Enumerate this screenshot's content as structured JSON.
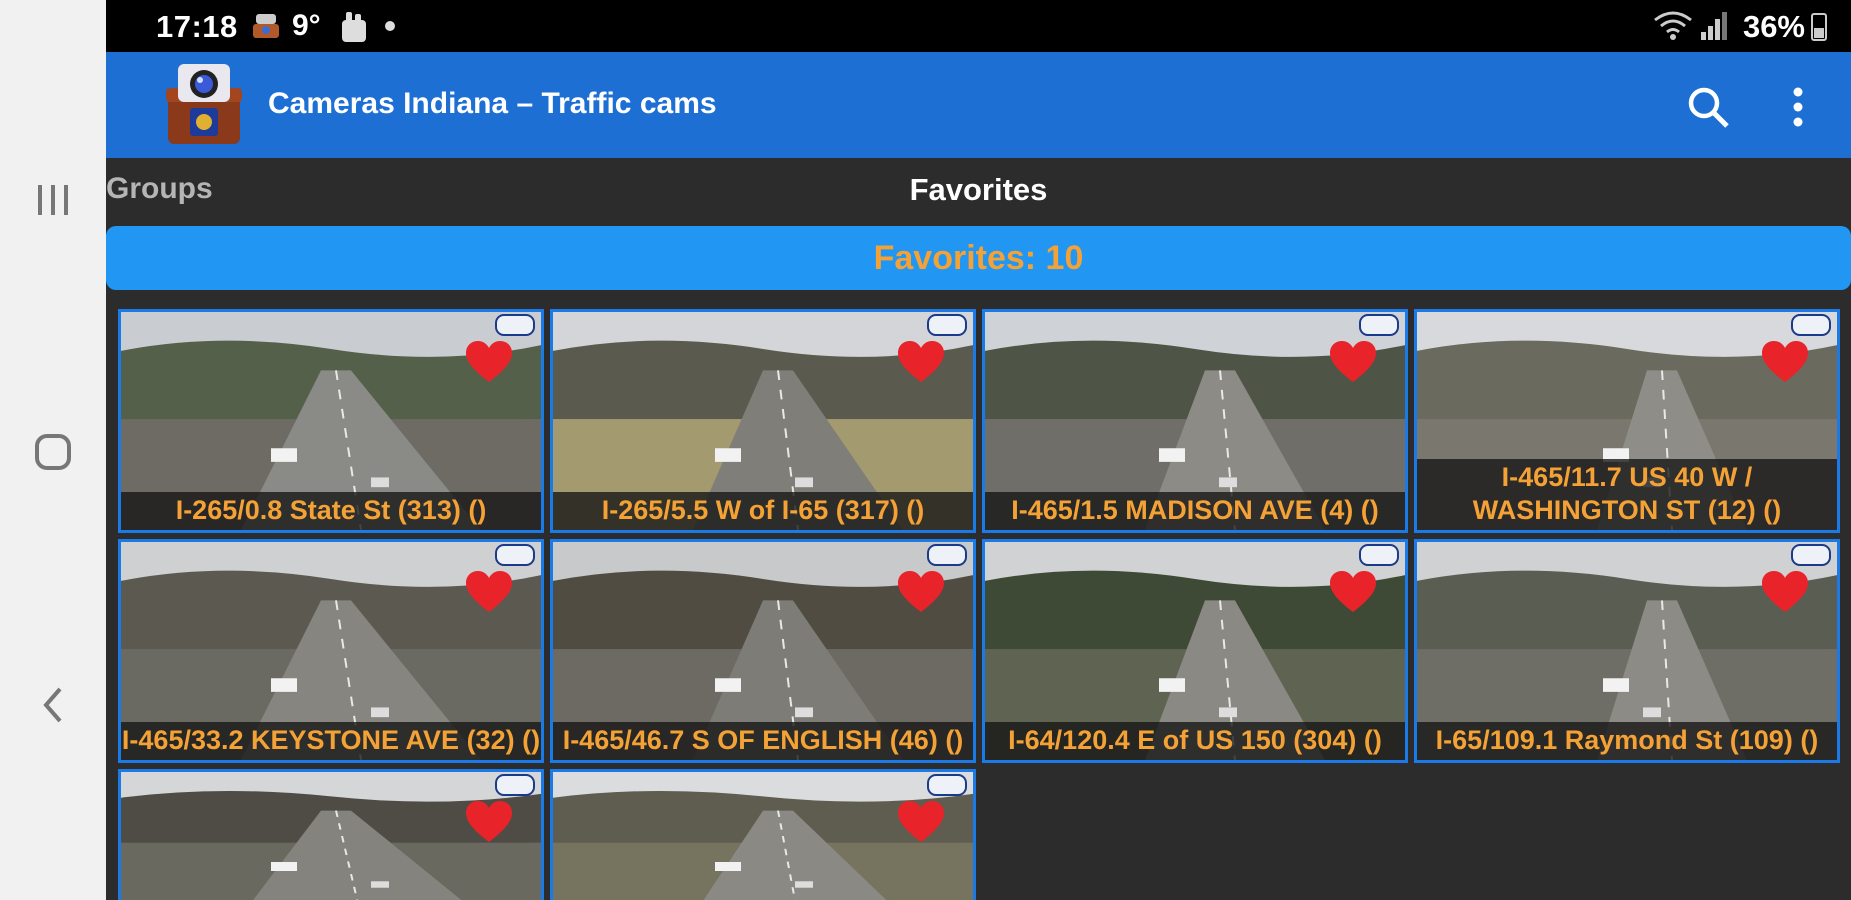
{
  "status_bar": {
    "time": "17:18",
    "temperature": "9°",
    "battery": "36%"
  },
  "app_bar": {
    "title": "Cameras Indiana – Traffic cams"
  },
  "tabs": {
    "groups": "Groups",
    "favorites": "Favorites"
  },
  "favorites_banner": "Favorites: 10",
  "colors": {
    "app_bar": "#1e6fd4",
    "banner": "#2196f3",
    "label_text": "#f4a235",
    "heart": "#e8232a",
    "background": "#2c2c2c"
  },
  "cameras": [
    {
      "label": "I-265/0.8 State St (313) ()",
      "favorite": true
    },
    {
      "label": "I-265/5.5 W of I-65  (317) ()",
      "favorite": true
    },
    {
      "label": "I-465/1.5 MADISON AVE (4) ()",
      "favorite": true
    },
    {
      "label": "I-465/11.7  US 40 W / WASHINGTON ST  (12) ()",
      "favorite": true
    },
    {
      "label": "I-465/33.2 KEYSTONE AVE  (32) ()",
      "favorite": true
    },
    {
      "label": "I-465/46.7  S OF ENGLISH (46) ()",
      "favorite": true
    },
    {
      "label": "I-64/120.4  E of US 150 (304) ()",
      "favorite": true
    },
    {
      "label": "I-65/109.1 Raymond St (109) ()",
      "favorite": true
    },
    {
      "label": "",
      "favorite": true
    },
    {
      "label": "",
      "favorite": true
    }
  ],
  "icons": {
    "nav_recents": "recents-icon",
    "nav_home": "home-icon",
    "nav_back": "back-icon",
    "search": "search-icon",
    "overflow": "more-vert-icon",
    "favorite": "heart-icon"
  }
}
